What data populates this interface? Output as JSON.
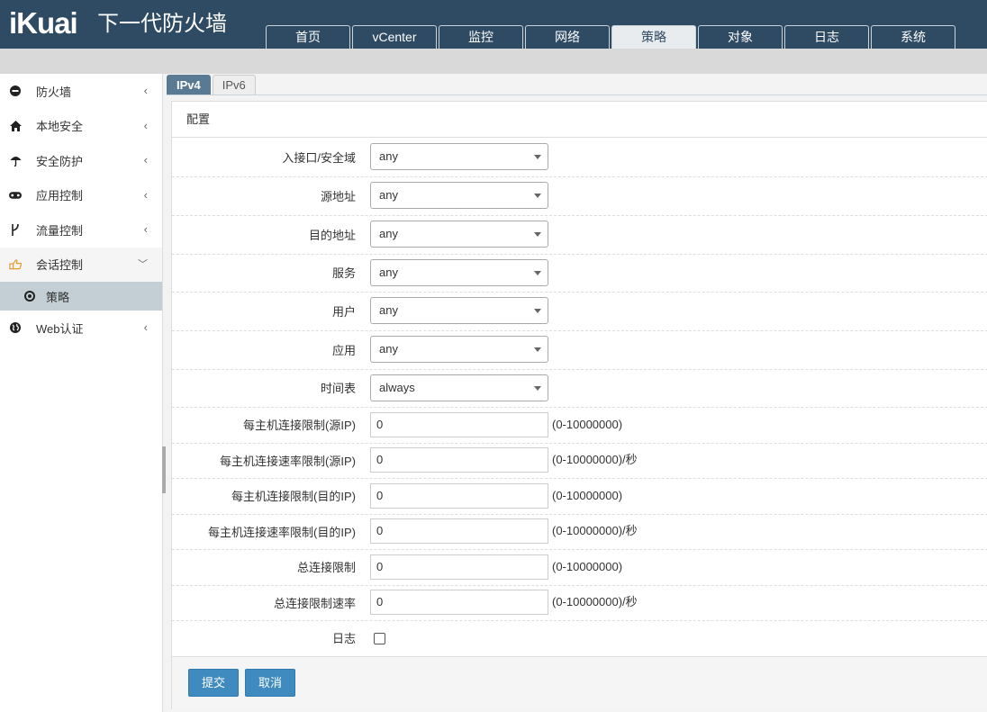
{
  "header": {
    "logo": "iKuai",
    "product": "下一代防火墙",
    "tabs": [
      {
        "label": "首页"
      },
      {
        "label": "vCenter"
      },
      {
        "label": "监控"
      },
      {
        "label": "网络"
      },
      {
        "label": "策略"
      },
      {
        "label": "对象"
      },
      {
        "label": "日志"
      },
      {
        "label": "系统"
      }
    ],
    "active_tab": "策略"
  },
  "sidebar": {
    "items": [
      {
        "label": "防火墙",
        "icon": "minus-circle-icon"
      },
      {
        "label": "本地安全",
        "icon": "home-icon"
      },
      {
        "label": "安全防护",
        "icon": "umbrella-icon"
      },
      {
        "label": "应用控制",
        "icon": "gamepad-icon"
      },
      {
        "label": "流量控制",
        "icon": "branch-icon"
      },
      {
        "label": "会话控制",
        "icon": "hand-pointer-icon"
      },
      {
        "label": "Web认证",
        "icon": "globe-icon"
      }
    ],
    "open_item": "会话控制",
    "sub_item": {
      "label": "策略",
      "icon": "dot-circle-icon"
    }
  },
  "subtabs": {
    "items": [
      {
        "label": "IPv4"
      },
      {
        "label": "IPv6"
      }
    ],
    "active": "IPv4"
  },
  "panel": {
    "title": "配置",
    "fields": {
      "ingress": {
        "label": "入接口/安全域",
        "value": "any"
      },
      "src_addr": {
        "label": "源地址",
        "value": "any"
      },
      "dst_addr": {
        "label": "目的地址",
        "value": "any"
      },
      "service": {
        "label": "服务",
        "value": "any"
      },
      "user": {
        "label": "用户",
        "value": "any"
      },
      "app": {
        "label": "应用",
        "value": "any"
      },
      "schedule": {
        "label": "时间表",
        "value": "always"
      },
      "conn_limit_src": {
        "label": "每主机连接限制(源IP)",
        "value": "0",
        "hint": "(0-10000000)"
      },
      "rate_limit_src": {
        "label": "每主机连接速率限制(源IP)",
        "value": "0",
        "hint": "(0-10000000)/秒"
      },
      "conn_limit_dst": {
        "label": "每主机连接限制(目的IP)",
        "value": "0",
        "hint": "(0-10000000)"
      },
      "rate_limit_dst": {
        "label": "每主机连接速率限制(目的IP)",
        "value": "0",
        "hint": "(0-10000000)/秒"
      },
      "total_limit": {
        "label": "总连接限制",
        "value": "0",
        "hint": "(0-10000000)"
      },
      "total_rate": {
        "label": "总连接限制速率",
        "value": "0",
        "hint": "(0-10000000)/秒"
      },
      "log": {
        "label": "日志",
        "checked": false
      }
    },
    "buttons": {
      "submit": "提交",
      "cancel": "取消"
    }
  },
  "colors": {
    "header_bg": "#2f4a63",
    "button_bg": "#3f8bc0",
    "active_subtab": "#5a7a94",
    "open_menu_icon": "#e69a2a",
    "selected_sub_bg": "#c3cfd4"
  }
}
